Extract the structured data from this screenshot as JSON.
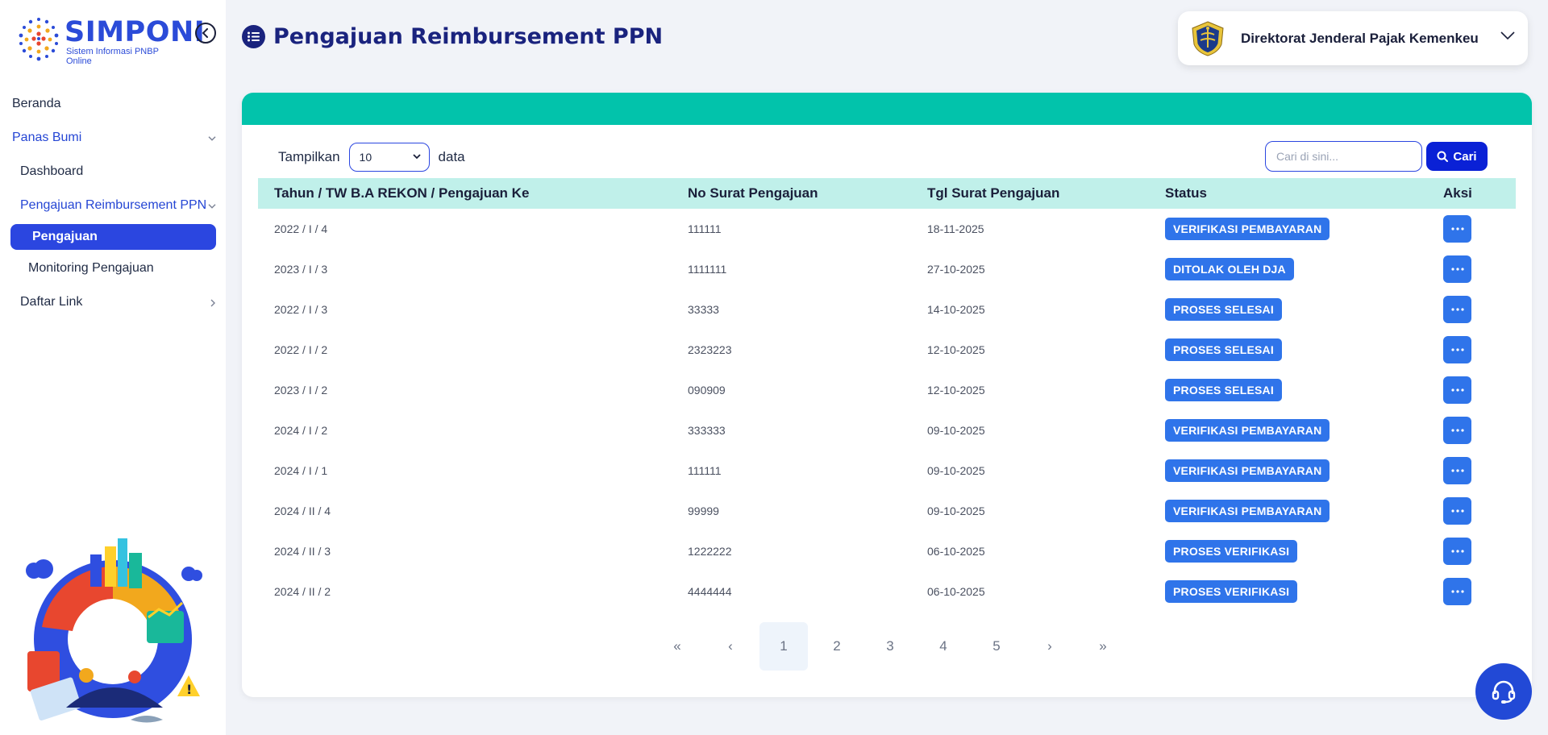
{
  "app": {
    "logo_title": "SIMPONI",
    "logo_subtitle": "Sistem Informasi PNBP Online"
  },
  "sidebar": {
    "items": [
      {
        "label": "Beranda"
      },
      {
        "label": "Panas Bumi"
      },
      {
        "label": "Dashboard"
      },
      {
        "label": "Pengajuan Reimbursement PPN"
      },
      {
        "label": "Pengajuan"
      },
      {
        "label": "Monitoring Pengajuan"
      },
      {
        "label": "Daftar Link"
      }
    ]
  },
  "header": {
    "title": "Pengajuan Reimbursement PPN",
    "org_name": "Direktorat Jenderal Pajak Kemenkeu"
  },
  "controls": {
    "show_label": "Tampilkan",
    "page_size": "10",
    "data_label": "data",
    "search_placeholder": "Cari di sini...",
    "search_button": "Cari"
  },
  "table": {
    "headers": [
      "Tahun / TW B.A REKON / Pengajuan Ke",
      "No Surat Pengajuan",
      "Tgl Surat Pengajuan",
      "Status",
      "Aksi"
    ],
    "rows": [
      {
        "period": "2022 / I / 4",
        "no": "111111",
        "date": "18-11-2025",
        "status": "VERIFIKASI PEMBAYARAN"
      },
      {
        "period": "2023 / I / 3",
        "no": "1111111",
        "date": "27-10-2025",
        "status": "DITOLAK OLEH DJA"
      },
      {
        "period": "2022 / I / 3",
        "no": "33333",
        "date": "14-10-2025",
        "status": "PROSES SELESAI"
      },
      {
        "period": "2022 / I / 2",
        "no": "2323223",
        "date": "12-10-2025",
        "status": "PROSES SELESAI"
      },
      {
        "period": "2023 / I / 2",
        "no": "090909",
        "date": "12-10-2025",
        "status": "PROSES SELESAI"
      },
      {
        "period": "2024 / I / 2",
        "no": "333333",
        "date": "09-10-2025",
        "status": "VERIFIKASI PEMBAYARAN"
      },
      {
        "period": "2024 / I / 1",
        "no": "111111",
        "date": "09-10-2025",
        "status": "VERIFIKASI PEMBAYARAN"
      },
      {
        "period": "2024 / II / 4",
        "no": "99999",
        "date": "09-10-2025",
        "status": "VERIFIKASI PEMBAYARAN"
      },
      {
        "period": "2024 / II / 3",
        "no": "1222222",
        "date": "06-10-2025",
        "status": "PROSES VERIFIKASI"
      },
      {
        "period": "2024 / II / 2",
        "no": "4444444",
        "date": "06-10-2025",
        "status": "PROSES VERIFIKASI"
      }
    ]
  },
  "pagination": {
    "first": "«",
    "prev": "‹",
    "pages": [
      "1",
      "2",
      "3",
      "4",
      "5"
    ],
    "current": "1",
    "next": "›",
    "last": "»"
  },
  "colors": {
    "accent": "#2b46e0",
    "header_band": "#02c3ab",
    "table_head": "#c0f0ea",
    "badge": "#2f74ea"
  },
  "icons": {
    "collapse": "chevron-left-circle-icon",
    "title": "list-icon",
    "org": "emblem-icon",
    "search": "search-icon",
    "action": "more-dots-icon",
    "support": "headset-icon"
  }
}
